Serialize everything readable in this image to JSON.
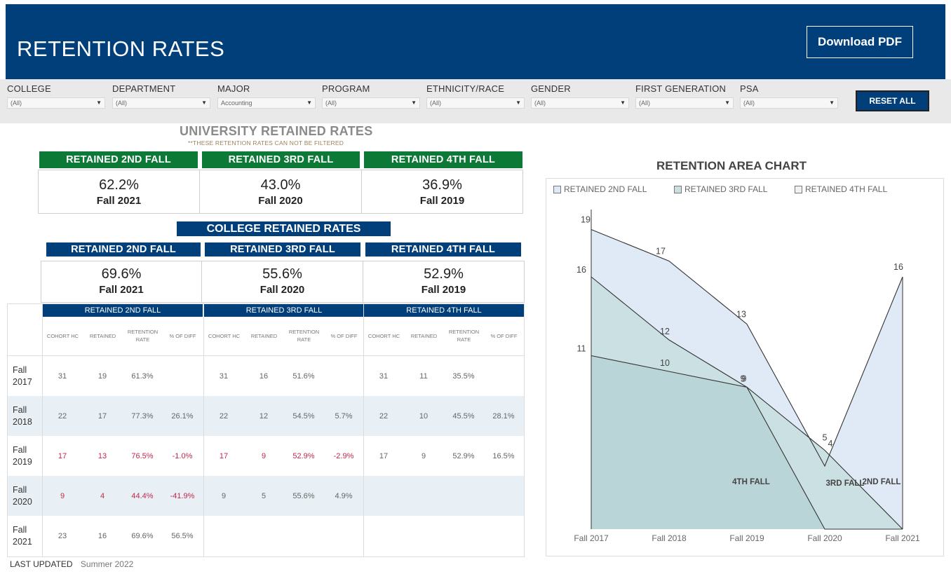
{
  "header": {
    "title": "RETENTION RATES",
    "download_label": "Download PDF"
  },
  "filters": [
    {
      "label": "COLLEGE",
      "value": "(All)"
    },
    {
      "label": "DEPARTMENT",
      "value": "(All)"
    },
    {
      "label": "MAJOR",
      "value": "Accounting"
    },
    {
      "label": "PROGRAM",
      "value": "(All)"
    },
    {
      "label": "ETHNICITY/RACE",
      "value": "(All)"
    },
    {
      "label": "GENDER",
      "value": "(All)"
    },
    {
      "label": "FIRST GENERATION",
      "value": "(All)"
    },
    {
      "label": "PSA",
      "value": "(All)"
    }
  ],
  "reset_label": "RESET ALL",
  "university": {
    "title": "UNIVERSITY RETAINED RATES",
    "note": "**THESE RETENTION RATES CAN NOT BE FILTERED",
    "tiles": [
      {
        "label": "RETAINED 2ND FALL",
        "rate": "62.2%",
        "term": "Fall 2021"
      },
      {
        "label": "RETAINED 3RD FALL",
        "rate": "43.0%",
        "term": "Fall 2020"
      },
      {
        "label": "RETAINED 4TH FALL",
        "rate": "36.9%",
        "term": "Fall 2019"
      }
    ]
  },
  "college": {
    "title": "COLLEGE RETAINED RATES",
    "tiles": [
      {
        "label": "RETAINED 2ND FALL",
        "rate": "69.6%",
        "term": "Fall 2021"
      },
      {
        "label": "RETAINED 3RD FALL",
        "rate": "55.6%",
        "term": "Fall 2020"
      },
      {
        "label": "RETAINED 4TH FALL",
        "rate": "52.9%",
        "term": "Fall 2019"
      }
    ]
  },
  "table": {
    "groups": [
      "RETAINED 2ND FALL",
      "RETAINED 3RD FALL",
      "RETAINED 4TH FALL"
    ],
    "columns": [
      "COHORT HC",
      "RETAINED",
      "RETENTION RATE",
      "% OF DIFF"
    ],
    "rows": [
      {
        "year": "Fall 2017",
        "red": false,
        "cells": [
          [
            "31",
            "19",
            "61.3%",
            ""
          ],
          [
            "31",
            "16",
            "51.6%",
            ""
          ],
          [
            "31",
            "11",
            "35.5%",
            ""
          ]
        ]
      },
      {
        "year": "Fall 2018",
        "red": false,
        "cells": [
          [
            "22",
            "17",
            "77.3%",
            "26.1%"
          ],
          [
            "22",
            "12",
            "54.5%",
            "5.7%"
          ],
          [
            "22",
            "10",
            "45.5%",
            "28.1%"
          ]
        ]
      },
      {
        "year": "Fall 2019",
        "red": true,
        "cells": [
          [
            "17",
            "13",
            "76.5%",
            "-1.0%"
          ],
          [
            "17",
            "9",
            "52.9%",
            "-2.9%"
          ],
          [
            "17",
            "9",
            "52.9%",
            "16.5%"
          ]
        ],
        "red_groups": [
          0,
          1
        ]
      },
      {
        "year": "Fall 2020",
        "red": true,
        "cells": [
          [
            "9",
            "4",
            "44.4%",
            "-41.9%"
          ],
          [
            "9",
            "5",
            "55.6%",
            "4.9%"
          ],
          [
            "",
            "",
            "",
            ""
          ]
        ],
        "red_groups": [
          0
        ]
      },
      {
        "year": "Fall 2021",
        "red": false,
        "cells": [
          [
            "23",
            "16",
            "69.6%",
            "56.5%"
          ],
          [
            "",
            "",
            "",
            ""
          ],
          [
            "",
            "",
            "",
            ""
          ]
        ]
      }
    ]
  },
  "last_updated": {
    "label": "LAST UPDATED",
    "value": "Summer 2022"
  },
  "chart_data": {
    "type": "area",
    "title": "RETENTION AREA CHART",
    "categories": [
      "Fall 2017",
      "Fall 2018",
      "Fall 2019",
      "Fall 2020",
      "Fall 2021"
    ],
    "series": [
      {
        "name": "RETAINED 2ND FALL",
        "values": [
          19,
          17,
          13,
          4,
          16
        ],
        "color": "#dde9f5",
        "end_label": "2ND FALL"
      },
      {
        "name": "RETAINED 3RD FALL",
        "values": [
          16,
          12,
          9,
          5,
          0
        ],
        "color": "#c9dfe0",
        "end_label": "3RD FALL"
      },
      {
        "name": "RETAINED 4TH FALL",
        "values": [
          11,
          10,
          9,
          0,
          0
        ],
        "color": "#b8d4d6",
        "end_label": "4TH FALL"
      }
    ],
    "legend_swatches": [
      "#dde9f5",
      "#c9dfe0",
      "#f1f1f1"
    ],
    "ylim": [
      0,
      20
    ],
    "legend_position": "top"
  }
}
